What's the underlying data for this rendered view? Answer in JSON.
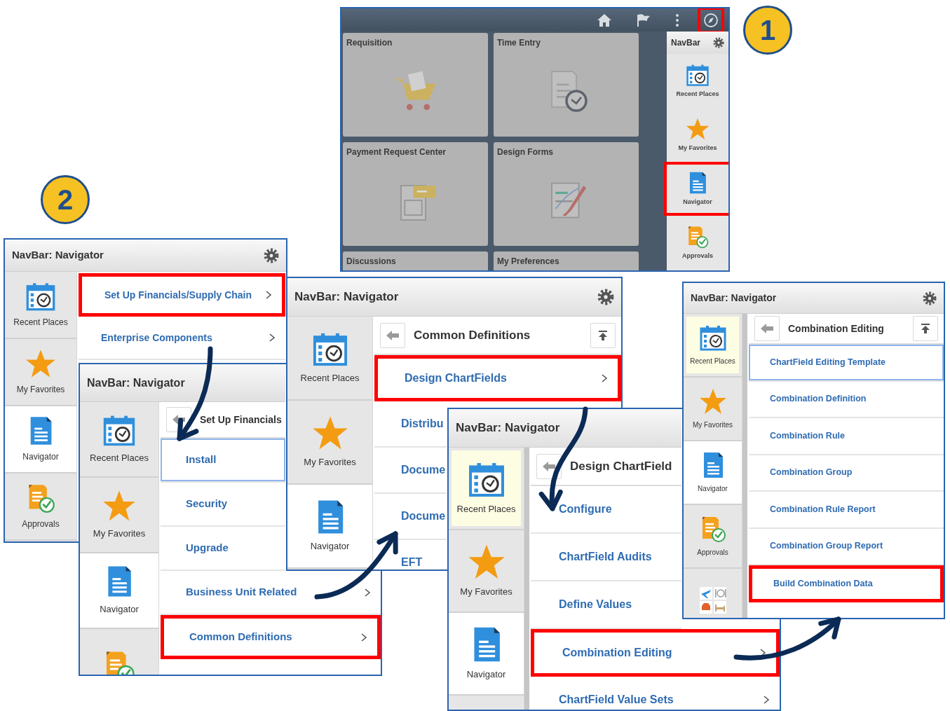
{
  "homepage": {
    "toolbar": [
      {
        "kind": "home",
        "highlighted": false
      },
      {
        "kind": "flag",
        "highlighted": false
      },
      {
        "kind": "more",
        "highlighted": false
      },
      {
        "kind": "compass",
        "highlighted": true
      }
    ],
    "tiles": [
      {
        "label": "Requisition",
        "kind": "cart"
      },
      {
        "label": "Time Entry",
        "kind": "timesheet"
      },
      {
        "label": "Payment Request Center",
        "kind": "payment"
      },
      {
        "label": "Design Forms",
        "kind": "form"
      },
      {
        "label": "Discussions",
        "kind": "blank"
      },
      {
        "label": "My Preferences",
        "kind": "blank"
      }
    ],
    "navbar": {
      "title": "NavBar",
      "items": [
        {
          "label": "Recent Places",
          "kind": "recent",
          "highlighted": false
        },
        {
          "label": "My Favorites",
          "kind": "favorites",
          "highlighted": false
        },
        {
          "label": "Navigator",
          "kind": "navigator",
          "highlighted": true
        },
        {
          "label": "Approvals",
          "kind": "approvals",
          "highlighted": false
        }
      ]
    }
  },
  "badges": [
    "1",
    "2"
  ],
  "panels": [
    {
      "title": "NavBar: Navigator",
      "gear": true,
      "sidebar": [
        {
          "label": "Recent Places",
          "kind": "recent",
          "selected": false,
          "active": false
        },
        {
          "label": "My Favorites",
          "kind": "favorites",
          "selected": false,
          "active": false
        },
        {
          "label": "Navigator",
          "kind": "navigator",
          "selected": true,
          "active": false
        },
        {
          "label": "Approvals",
          "kind": "approvals",
          "selected": false,
          "active": false
        }
      ],
      "items": [
        {
          "label": "Set Up Financials/Supply Chain",
          "chevron": true,
          "highlighted": true,
          "focused": false
        },
        {
          "label": "Enterprise Components",
          "chevron": true,
          "highlighted": false,
          "focused": false
        }
      ]
    },
    {
      "title": "NavBar: Navigator",
      "sidebar": [
        {
          "label": "Recent Places",
          "kind": "recent",
          "selected": false,
          "active": false
        },
        {
          "label": "My Favorites",
          "kind": "favorites",
          "selected": false,
          "active": false
        },
        {
          "label": "Navigator",
          "kind": "navigator",
          "selected": true,
          "active": false
        },
        {
          "kind": "approvals",
          "selected": false,
          "active": false
        }
      ],
      "menu_header": {
        "title": "Set Up Financials"
      },
      "items": [
        {
          "label": "Install",
          "highlighted": false,
          "focused": true
        },
        {
          "label": "Security",
          "highlighted": false,
          "focused": false
        },
        {
          "label": "Upgrade",
          "highlighted": false,
          "focused": false
        },
        {
          "label": "Business Unit Related",
          "chevron": true,
          "highlighted": false,
          "focused": false
        },
        {
          "label": "Common Definitions",
          "chevron": true,
          "highlighted": true,
          "focused": false
        }
      ]
    },
    {
      "title": "NavBar: Navigator",
      "gear": true,
      "sidebar": [
        {
          "label": "Recent Places",
          "kind": "recent",
          "selected": false,
          "active": false
        },
        {
          "label": "My Favorites",
          "kind": "favorites",
          "selected": false,
          "active": false
        },
        {
          "label": "Navigator",
          "kind": "navigator",
          "selected": true,
          "active": false
        }
      ],
      "menu_header": {
        "title": "Common Definitions",
        "top_button": true
      },
      "items": [
        {
          "label": "Design ChartFields",
          "chevron": true,
          "highlighted": true,
          "focused": false
        },
        {
          "label": "Distribu",
          "highlighted": false,
          "focused": false
        },
        {
          "label": "Docume",
          "highlighted": false,
          "focused": false
        },
        {
          "label": "Docume",
          "highlighted": false,
          "focused": false
        },
        {
          "label": "EFT",
          "highlighted": false,
          "focused": false
        }
      ]
    },
    {
      "title": "NavBar: Navigator",
      "sidebar": [
        {
          "label": "Recent Places",
          "kind": "recent",
          "selected": false,
          "active": true
        },
        {
          "label": "My Favorites",
          "kind": "favorites",
          "selected": false,
          "active": false
        },
        {
          "label": "Navigator",
          "kind": "navigator",
          "selected": true,
          "active": false
        }
      ],
      "menu_header": {
        "title": "Design ChartField"
      },
      "items": [
        {
          "label": "Configure",
          "highlighted": false,
          "focused": false
        },
        {
          "label": "ChartField Audits",
          "highlighted": false,
          "focused": false
        },
        {
          "label": "Define Values",
          "highlighted": false,
          "focused": false
        },
        {
          "label": "Combination Editing",
          "chevron": true,
          "highlighted": true,
          "focused": false
        },
        {
          "label": "ChartField Value Sets",
          "chevron": true,
          "highlighted": false,
          "focused": false
        }
      ]
    },
    {
      "title": "NavBar: Navigator",
      "gear": true,
      "sidebar": [
        {
          "label": "Recent Places",
          "kind": "recent",
          "selected": false,
          "active": true
        },
        {
          "label": "My Favorites",
          "kind": "favorites",
          "selected": false,
          "active": false
        },
        {
          "label": "Navigator",
          "kind": "navigator",
          "selected": true,
          "active": false
        },
        {
          "label": "Approvals",
          "kind": "approvals",
          "selected": false,
          "active": false
        },
        {
          "kind": "travel",
          "selected": false,
          "active": false
        }
      ],
      "menu_header": {
        "title": "Combination Editing",
        "top_button": true
      },
      "items": [
        {
          "label": "ChartField Editing Template",
          "highlighted": false,
          "focused": true
        },
        {
          "label": "Combination Definition",
          "highlighted": false,
          "focused": false
        },
        {
          "label": "Combination Rule",
          "highlighted": false,
          "focused": false
        },
        {
          "label": "Combination Group",
          "highlighted": false,
          "focused": false
        },
        {
          "label": "Combination Rule Report",
          "highlighted": false,
          "focused": false
        },
        {
          "label": "Combination Group Report",
          "highlighted": false,
          "focused": false
        },
        {
          "label": "Build Combination Data",
          "highlighted": true,
          "focused": false
        }
      ]
    }
  ]
}
